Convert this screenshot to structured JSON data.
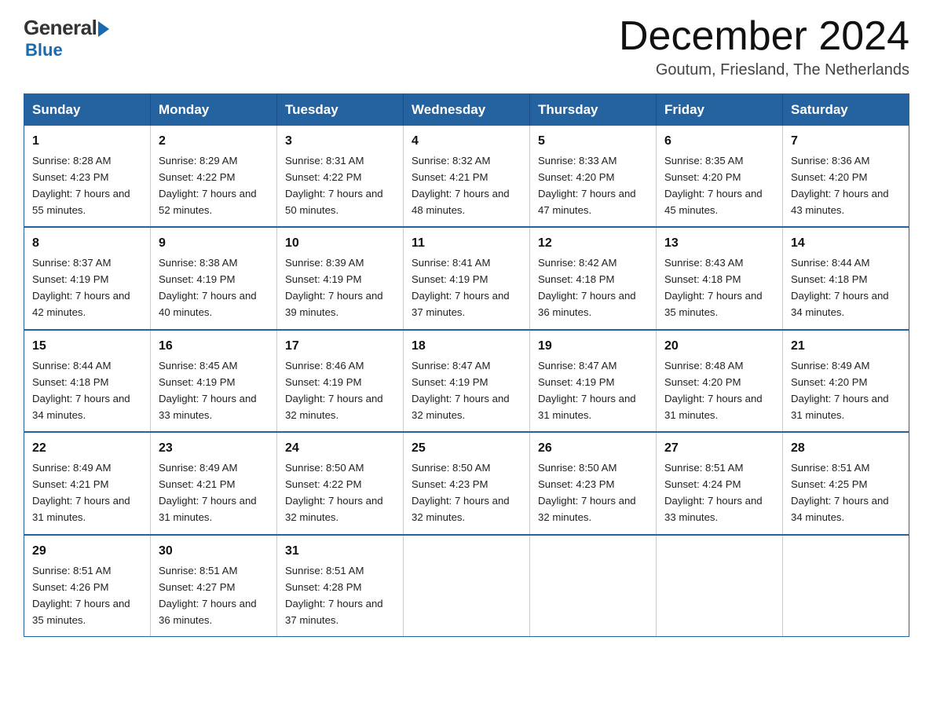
{
  "logo": {
    "general": "General",
    "blue": "Blue"
  },
  "title": {
    "month": "December 2024",
    "location": "Goutum, Friesland, The Netherlands"
  },
  "days_header": [
    "Sunday",
    "Monday",
    "Tuesday",
    "Wednesday",
    "Thursday",
    "Friday",
    "Saturday"
  ],
  "weeks": [
    [
      {
        "day": "1",
        "sunrise": "8:28 AM",
        "sunset": "4:23 PM",
        "daylight": "7 hours and 55 minutes."
      },
      {
        "day": "2",
        "sunrise": "8:29 AM",
        "sunset": "4:22 PM",
        "daylight": "7 hours and 52 minutes."
      },
      {
        "day": "3",
        "sunrise": "8:31 AM",
        "sunset": "4:22 PM",
        "daylight": "7 hours and 50 minutes."
      },
      {
        "day": "4",
        "sunrise": "8:32 AM",
        "sunset": "4:21 PM",
        "daylight": "7 hours and 48 minutes."
      },
      {
        "day": "5",
        "sunrise": "8:33 AM",
        "sunset": "4:20 PM",
        "daylight": "7 hours and 47 minutes."
      },
      {
        "day": "6",
        "sunrise": "8:35 AM",
        "sunset": "4:20 PM",
        "daylight": "7 hours and 45 minutes."
      },
      {
        "day": "7",
        "sunrise": "8:36 AM",
        "sunset": "4:20 PM",
        "daylight": "7 hours and 43 minutes."
      }
    ],
    [
      {
        "day": "8",
        "sunrise": "8:37 AM",
        "sunset": "4:19 PM",
        "daylight": "7 hours and 42 minutes."
      },
      {
        "day": "9",
        "sunrise": "8:38 AM",
        "sunset": "4:19 PM",
        "daylight": "7 hours and 40 minutes."
      },
      {
        "day": "10",
        "sunrise": "8:39 AM",
        "sunset": "4:19 PM",
        "daylight": "7 hours and 39 minutes."
      },
      {
        "day": "11",
        "sunrise": "8:41 AM",
        "sunset": "4:19 PM",
        "daylight": "7 hours and 37 minutes."
      },
      {
        "day": "12",
        "sunrise": "8:42 AM",
        "sunset": "4:18 PM",
        "daylight": "7 hours and 36 minutes."
      },
      {
        "day": "13",
        "sunrise": "8:43 AM",
        "sunset": "4:18 PM",
        "daylight": "7 hours and 35 minutes."
      },
      {
        "day": "14",
        "sunrise": "8:44 AM",
        "sunset": "4:18 PM",
        "daylight": "7 hours and 34 minutes."
      }
    ],
    [
      {
        "day": "15",
        "sunrise": "8:44 AM",
        "sunset": "4:18 PM",
        "daylight": "7 hours and 34 minutes."
      },
      {
        "day": "16",
        "sunrise": "8:45 AM",
        "sunset": "4:19 PM",
        "daylight": "7 hours and 33 minutes."
      },
      {
        "day": "17",
        "sunrise": "8:46 AM",
        "sunset": "4:19 PM",
        "daylight": "7 hours and 32 minutes."
      },
      {
        "day": "18",
        "sunrise": "8:47 AM",
        "sunset": "4:19 PM",
        "daylight": "7 hours and 32 minutes."
      },
      {
        "day": "19",
        "sunrise": "8:47 AM",
        "sunset": "4:19 PM",
        "daylight": "7 hours and 31 minutes."
      },
      {
        "day": "20",
        "sunrise": "8:48 AM",
        "sunset": "4:20 PM",
        "daylight": "7 hours and 31 minutes."
      },
      {
        "day": "21",
        "sunrise": "8:49 AM",
        "sunset": "4:20 PM",
        "daylight": "7 hours and 31 minutes."
      }
    ],
    [
      {
        "day": "22",
        "sunrise": "8:49 AM",
        "sunset": "4:21 PM",
        "daylight": "7 hours and 31 minutes."
      },
      {
        "day": "23",
        "sunrise": "8:49 AM",
        "sunset": "4:21 PM",
        "daylight": "7 hours and 31 minutes."
      },
      {
        "day": "24",
        "sunrise": "8:50 AM",
        "sunset": "4:22 PM",
        "daylight": "7 hours and 32 minutes."
      },
      {
        "day": "25",
        "sunrise": "8:50 AM",
        "sunset": "4:23 PM",
        "daylight": "7 hours and 32 minutes."
      },
      {
        "day": "26",
        "sunrise": "8:50 AM",
        "sunset": "4:23 PM",
        "daylight": "7 hours and 32 minutes."
      },
      {
        "day": "27",
        "sunrise": "8:51 AM",
        "sunset": "4:24 PM",
        "daylight": "7 hours and 33 minutes."
      },
      {
        "day": "28",
        "sunrise": "8:51 AM",
        "sunset": "4:25 PM",
        "daylight": "7 hours and 34 minutes."
      }
    ],
    [
      {
        "day": "29",
        "sunrise": "8:51 AM",
        "sunset": "4:26 PM",
        "daylight": "7 hours and 35 minutes."
      },
      {
        "day": "30",
        "sunrise": "8:51 AM",
        "sunset": "4:27 PM",
        "daylight": "7 hours and 36 minutes."
      },
      {
        "day": "31",
        "sunrise": "8:51 AM",
        "sunset": "4:28 PM",
        "daylight": "7 hours and 37 minutes."
      },
      null,
      null,
      null,
      null
    ]
  ]
}
